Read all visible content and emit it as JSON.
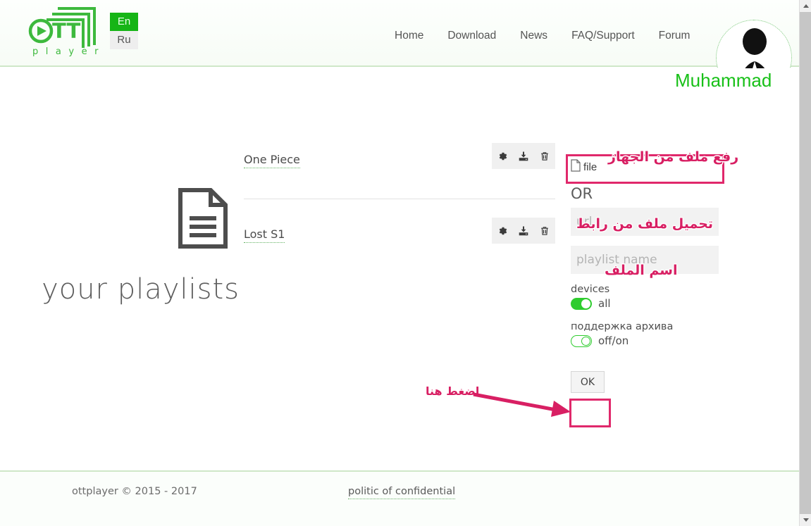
{
  "header": {
    "logo": {
      "brand": "OTT",
      "word": "p l a y e r",
      "icon": "ott-player-logo-icon"
    },
    "language": {
      "active": "En",
      "options": [
        "En",
        "Ru"
      ]
    },
    "nav": [
      {
        "label": "Home",
        "name": "nav-home"
      },
      {
        "label": "Download",
        "name": "nav-download"
      },
      {
        "label": "News",
        "name": "nav-news"
      },
      {
        "label": "FAQ/Support",
        "name": "nav-faq-support"
      },
      {
        "label": "Forum",
        "name": "nav-forum"
      }
    ],
    "user": {
      "name": "Muhammad",
      "avatar_icon": "user-silhouette-avatar-icon",
      "name_color": "#18c018"
    }
  },
  "main": {
    "heading": "your playlists",
    "doc_icon": "document-lines-icon",
    "playlists": [
      {
        "name": "One Piece",
        "actions": [
          {
            "label": "settings",
            "icon": "gear-icon"
          },
          {
            "label": "download",
            "icon": "download-icon"
          },
          {
            "label": "delete",
            "icon": "trash-icon"
          }
        ]
      },
      {
        "name": "Lost S1",
        "actions": [
          {
            "label": "settings",
            "icon": "gear-icon"
          },
          {
            "label": "download",
            "icon": "download-icon"
          },
          {
            "label": "delete",
            "icon": "trash-icon"
          }
        ]
      }
    ]
  },
  "upload_panel": {
    "file_label": "file",
    "file_icon": "file-page-icon",
    "or_label": "OR",
    "url_input": {
      "value": "",
      "placeholder": "url"
    },
    "name_input": {
      "value": "",
      "placeholder": "playlist name"
    },
    "devices": {
      "label": "devices",
      "toggle_state": "on",
      "toggle_label": "all"
    },
    "archive": {
      "label": "поддержка архива",
      "toggle_state": "off",
      "toggle_label": "off/on"
    },
    "ok_label": "OK"
  },
  "footer": {
    "copyright": "ottplayer © 2015 - 2017",
    "link": "politic of confidential"
  },
  "annotations": {
    "color": "#d81f63",
    "upload_from_device": "رفع ملف من الجهاز",
    "upload_from_link": "تحميل ملف من رابط",
    "file_name": "اسم الملف",
    "press_here": "اضغط هنا"
  },
  "scrollbar": {
    "up_arrow": "chevron-up-icon",
    "down_arrow": "chevron-down-icon"
  }
}
